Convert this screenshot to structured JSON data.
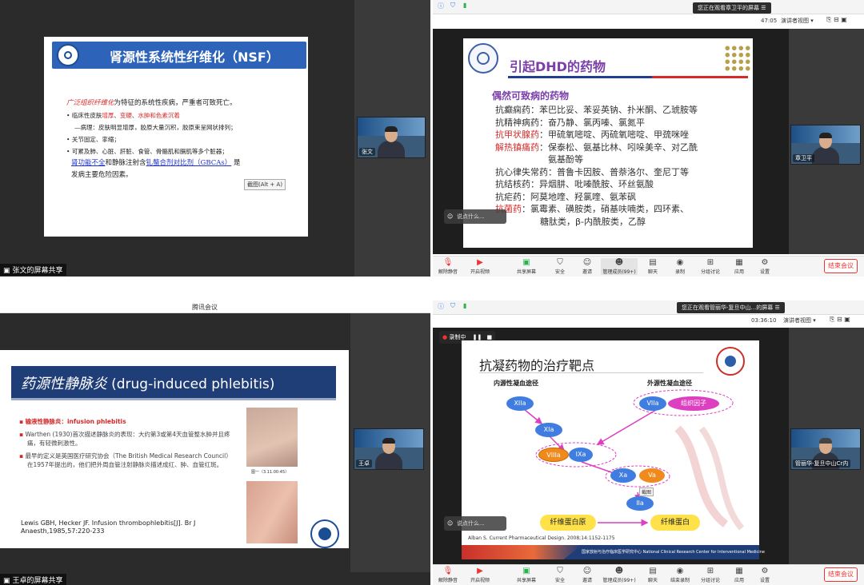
{
  "q1": {
    "slide_title": "肾源性系统性纤维化（NSF）",
    "lines": [
      {
        "red": "广泛组织纤维化",
        "rest": "为特征的系统性疾病，严重者可致死亡。"
      },
      {
        "bullet": "•",
        "pre": "临床性皮肤",
        "red1": "增厚",
        "mid": "、",
        "red2": "变硬",
        "mid2": "、",
        "red3": "水肿和色素沉着"
      },
      {
        "text": "—病理：皮肤明显增厚，胶原大量沉积，胶原束呈网状排列；"
      },
      {
        "bullet": "•",
        "text": "关节固定、挛缩；"
      },
      {
        "bullet": "•",
        "text": "可累及肺、心脏、肝脏、食管、骨骼肌和膈肌等多个脏器；"
      },
      {
        "blue": "肾功能不全",
        "pre": "和静脉注射含",
        "blue2": "钆螯合剂对比剂（GBCAs）",
        "post": "是"
      },
      {
        "text": "发病主要危险因素。"
      }
    ],
    "screenshot_hint": "截图(Alt + A)",
    "cam_name": "张文",
    "share_label": "张文的屏幕共享"
  },
  "q2": {
    "viewing_label": "您正在观看章卫平的屏幕",
    "timer": "47:05",
    "view_mode": "演讲者视图",
    "slide_title": "引起DHD的药物",
    "subtitle": "偶然可致病的药物",
    "drugs": [
      {
        "cls": "抗癫痫药",
        "items": "：苯巴比妥、苯妥英钠、扑米酮、乙琥胺等",
        "red": false
      },
      {
        "cls": "抗精神病药",
        "items": "：奋乃静、氯丙嗪、氯氮平",
        "red": false
      },
      {
        "cls": "抗甲状腺药",
        "items": "：甲硫氧嘧啶、丙硫氧嘧啶、甲巯咪唑",
        "red": true
      },
      {
        "cls": "解热镇痛药",
        "items": "：保泰松、氨基比林、吲哚美辛、对乙酰",
        "red": true
      },
      {
        "cls": "",
        "items": "氨基酚等",
        "red": false
      },
      {
        "cls": "抗心律失常药",
        "items": "：普鲁卡因胺、普萘洛尔、奎尼丁等",
        "red": false
      },
      {
        "cls": "抗结核药",
        "items": "：异烟肼、吡嗪酰胺、环丝氨酸",
        "red": false
      },
      {
        "cls": "抗疟药",
        "items": "：阿莫地喹、羟氯喹、氨苯砜",
        "red": false
      },
      {
        "cls": "抗菌药",
        "items": "：氯霉素、磺胺类，硝基呋喃类，四环素、",
        "red": true
      },
      {
        "cls": "",
        "items": "糖肽类，β-内酰胺类，乙醇",
        "red": false
      }
    ],
    "cam_name": "章卫平",
    "reaction_placeholder": "说点什么...",
    "toolbar": [
      "解除静音",
      "开启视频",
      "共享屏幕",
      "安全",
      "邀请",
      "管理成员(99+)",
      "聊天",
      "录制",
      "分组讨论",
      "应用",
      "设置"
    ],
    "end_label": "结束会议"
  },
  "q3": {
    "window_title": "腾讯会议",
    "slide_title_cn": "药源性静脉炎",
    "slide_title_en": "(drug-induced phlebitis)",
    "bullets": [
      {
        "red": "输液性静脉炎：infusion phlebitis",
        "text": ""
      },
      {
        "red": "",
        "text": "Warthen (1930)首次描述静脉炎的表现：大约第3或第4天血管整水肿并且疼痛，有轻微刺激性。"
      },
      {
        "red": "",
        "text": "最早的定义是英国医疗研究协会（The British Medical Research Council）在1957年提出的，他们把外周血管注射静脉炎描述成红、肿、血管红斑。"
      }
    ],
    "reference": "Lewis GBH, Hecker JF. Infusion thrombophlebitis[J]. Br J Anaesth,1985,57:220-233",
    "photo_caption": "图一（3.11.00:45）",
    "cam_name": "王卓",
    "share_label": "王卓的屏幕共享"
  },
  "q4": {
    "viewing_label": "您正在观看管丽华-复旦中山...的屏幕",
    "timer": "03:36:10",
    "view_mode": "演讲者视图",
    "recording": "录制中",
    "slide_title": "抗凝药物的治疗靶点",
    "intrinsic": "内源性凝血途径",
    "extrinsic": "外源性凝血途径",
    "nodes": {
      "XIIa": "XIIa",
      "XIa": "XIa",
      "VIIIa": "VIIIa",
      "IXa": "IXa",
      "VIIa": "VIIa",
      "TF": "组织因子",
      "Xa": "Xa",
      "Va": "Va",
      "IIa": "IIa"
    },
    "fibrinogen": "纤维蛋白原",
    "fibrin": "纤维蛋白",
    "tooltip": "截图",
    "citation": "Alban S. Current Pharmaceutical Design. 2008;14:1152-1175",
    "footer": "国家放射与治疗临床医学研究中心  National Clinical Research Center for Interventional Medicine",
    "cam_name": "管丽华-复旦中山Cr内",
    "reaction_placeholder": "说点什么...",
    "toolbar": [
      "解除静音",
      "开启视频",
      "共享屏幕",
      "安全",
      "邀请",
      "管理成员(99+)",
      "聊天",
      "结束录制",
      "分组讨论",
      "应用",
      "设置"
    ],
    "end_label": "结束会议"
  },
  "colors": {
    "nsf_blue": "#2d63b8",
    "dhd_purple": "#7a3fa8",
    "red": "#d42a2a",
    "node_blue": "#3f7ee0",
    "node_orange": "#f08a1c",
    "node_pink": "#dc3fbf",
    "node_yellow": "#ffe24a"
  }
}
